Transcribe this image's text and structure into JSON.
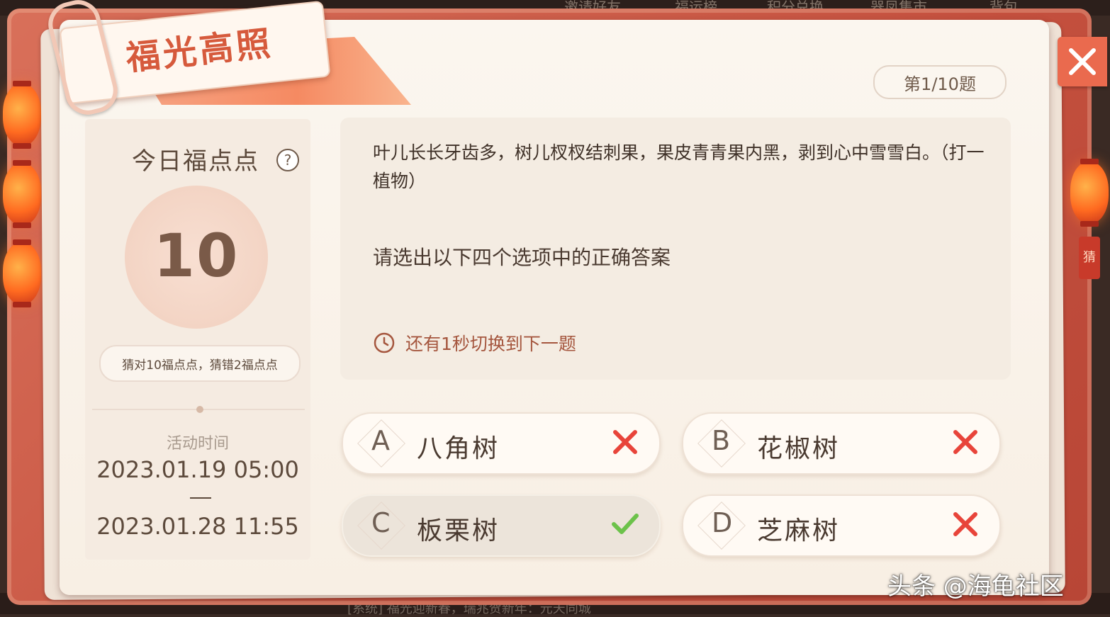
{
  "top_nav": [
    "邀请好友",
    "福运榜",
    "积分兑换",
    "器凤集市",
    "背包"
  ],
  "bottom_text": "[系统] 福光迎新春，瑞兆贺新年：元天同城",
  "title": "福光高照",
  "question_counter": "第1/10题",
  "left_panel": {
    "points_title": "今日福点点",
    "help_symbol": "?",
    "points_value": "10",
    "rule": "猜对10福点点，猜错2福点点",
    "time_label": "活动时间",
    "time_start": "2023.01.19 05:00",
    "time_separator": "—",
    "time_end": "2023.01.28 11:55"
  },
  "question": {
    "riddle": "叶儿长长牙齿多，树儿杈杈结刺果，果皮青青果内黑，剥到心中雪雪白。（打一植物）",
    "instruction": "请选出以下四个选项中的正确答案",
    "timer_text": "还有1秒切换到下一题"
  },
  "options": [
    {
      "letter": "A",
      "label": "八角树",
      "result": "wrong"
    },
    {
      "letter": "B",
      "label": "花椒树",
      "result": "wrong"
    },
    {
      "letter": "C",
      "label": "板栗树",
      "result": "correct"
    },
    {
      "letter": "D",
      "label": "芝麻树",
      "result": "wrong"
    }
  ],
  "side_tag": "猜",
  "watermark": "头条 @海龟社区",
  "icons": {
    "close": "close-icon",
    "clock": "clock-icon",
    "wrong": "cross-icon",
    "correct": "check-icon"
  },
  "colors": {
    "frame_red": "#c4503e",
    "title_text": "#d65a3c",
    "wrong_mark": "#e8443a",
    "correct_mark": "#6cc24a",
    "timer_text": "#a5563e"
  }
}
